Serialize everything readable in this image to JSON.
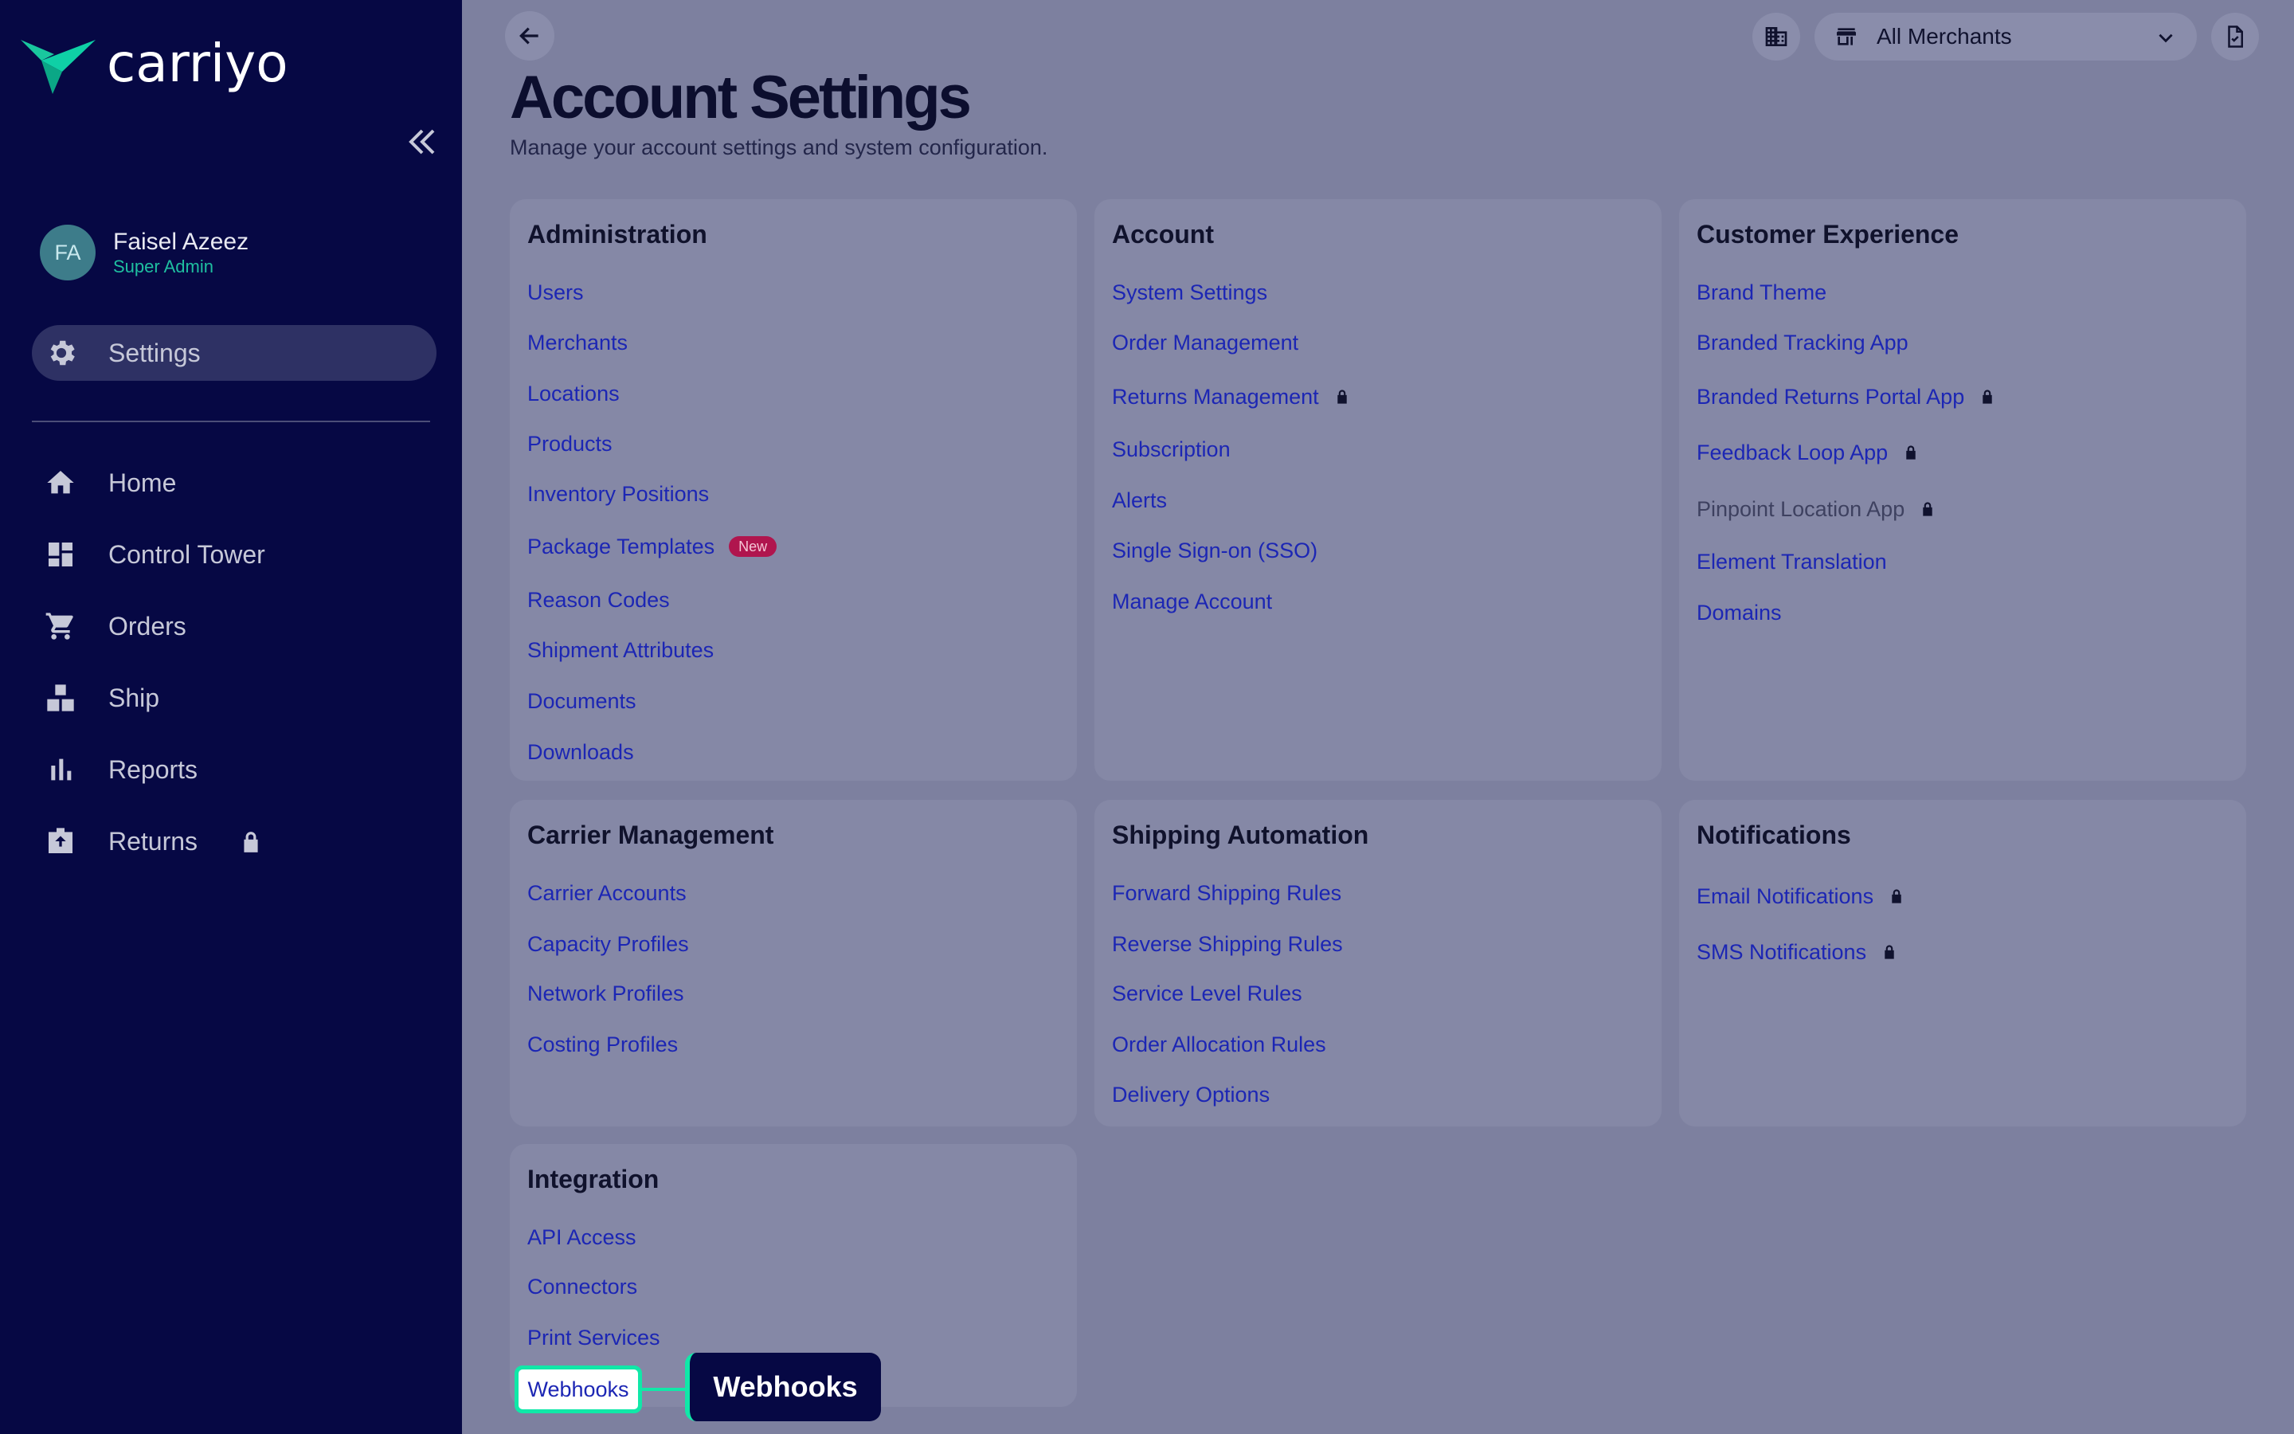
{
  "brand": {
    "name": "carriyo",
    "accent": "#10e8a8",
    "sidebar_bg": "#060844"
  },
  "user": {
    "initials": "FA",
    "name": "Faisel Azeez",
    "role": "Super Admin"
  },
  "sidebar": {
    "active": {
      "label": "Settings",
      "icon": "gear-icon"
    },
    "items": [
      {
        "label": "Home",
        "icon": "home-icon"
      },
      {
        "label": "Control Tower",
        "icon": "dashboard-icon"
      },
      {
        "label": "Orders",
        "icon": "cart-icon"
      },
      {
        "label": "Ship",
        "icon": "boxes-icon"
      },
      {
        "label": "Reports",
        "icon": "bar-chart-icon"
      },
      {
        "label": "Returns",
        "icon": "return-box-icon",
        "locked": true
      }
    ]
  },
  "header": {
    "merchant_select": "All Merchants",
    "title": "Account Settings",
    "subtitle": "Manage your account settings and system configuration."
  },
  "cards": {
    "administration": {
      "title": "Administration",
      "links": [
        "Users",
        "Merchants",
        "Locations",
        "Products",
        "Inventory Positions",
        "Package Templates",
        "Reason Codes",
        "Shipment Attributes",
        "Documents",
        "Downloads"
      ],
      "new_badge": "New"
    },
    "account": {
      "title": "Account",
      "links": [
        "System Settings",
        "Order Management",
        "Returns Management",
        "Subscription",
        "Alerts",
        "Single Sign-on (SSO)",
        "Manage Account"
      ]
    },
    "customer_experience": {
      "title": "Customer Experience",
      "links": [
        "Brand Theme",
        "Branded Tracking App",
        "Branded Returns Portal App",
        "Feedback Loop App",
        "Pinpoint Location App",
        "Element Translation",
        "Domains"
      ]
    },
    "carrier_management": {
      "title": "Carrier Management",
      "links": [
        "Carrier Accounts",
        "Capacity Profiles",
        "Network Profiles",
        "Costing Profiles"
      ]
    },
    "shipping_automation": {
      "title": "Shipping Automation",
      "links": [
        "Forward Shipping Rules",
        "Reverse Shipping Rules",
        "Service Level Rules",
        "Order Allocation Rules",
        "Delivery Options"
      ]
    },
    "notifications": {
      "title": "Notifications",
      "links": [
        "Email Notifications",
        "SMS Notifications"
      ]
    },
    "integration": {
      "title": "Integration",
      "links": [
        "API Access",
        "Connectors",
        "Print Services",
        "Webhooks"
      ]
    }
  },
  "tooltip": {
    "label": "Webhooks"
  }
}
